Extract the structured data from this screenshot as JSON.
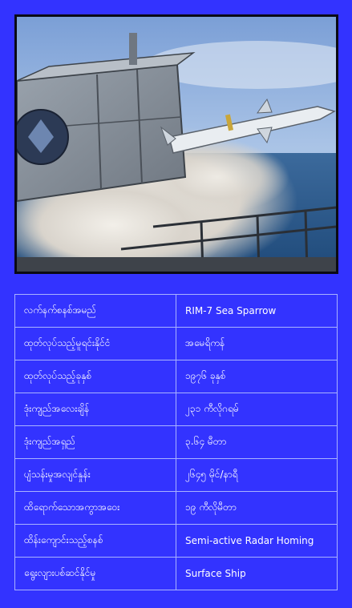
{
  "image": {
    "subject": "missile-launch-photo"
  },
  "specs": [
    {
      "label": "လက်နက်စနစ်အမည်",
      "value": "RIM-7 Sea Sparrow"
    },
    {
      "label": "ထုတ်လုပ်သည့်မူရင်းနိုင်ငံ",
      "value": "အမေရိကန်"
    },
    {
      "label": "ထုတ်လုပ်သည့်ခုနှစ်",
      "value": "၁၉၇၆ ခုနှစ်"
    },
    {
      "label": "ဒုံးကျည်အလေးချိန်",
      "value": "၂၃၁ ကီလိုဂရမ်"
    },
    {
      "label": "ဒုံးကျည်အရှည်",
      "value": "၃.၆၄ မီတာ"
    },
    {
      "label": "ပျံသန်းမှုအလျင်နှုန်း",
      "value": "၂၆၄၅ မိုင်/နာရီ"
    },
    {
      "label": "ထိရောက်သောအကွာအဝေး",
      "value": "၁၉ ကီလိုမီတာ"
    },
    {
      "label": "ထိန်းကျောင်းသည့်စနစ်",
      "value": "Semi-active Radar Homing"
    },
    {
      "label": "ရွေးလျားပစ်ဆင်နိုင်မှု",
      "value": "Surface Ship"
    }
  ],
  "colors": {
    "background": "#3333ff",
    "table_border": "#a9b2ff",
    "text": "#ffffff"
  }
}
